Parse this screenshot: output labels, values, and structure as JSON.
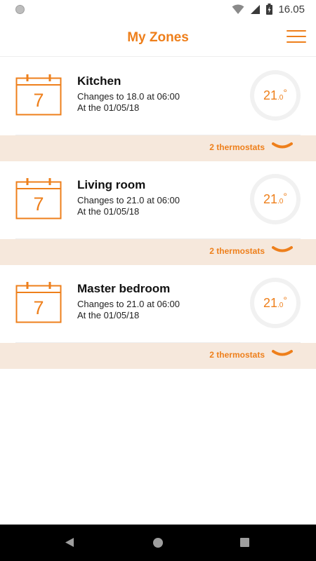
{
  "status_bar": {
    "time": "16.05",
    "icons": [
      "notification-dot-icon",
      "wifi-icon",
      "cell-signal-icon",
      "battery-charging-icon"
    ]
  },
  "header": {
    "title": "My Zones",
    "menu_icon": "hamburger-menu-icon"
  },
  "colors": {
    "accent": "#ee7f1b",
    "thermostat_bar_bg": "#f6e8dc",
    "nav_bar_bg": "#000000"
  },
  "zones": [
    {
      "name": "Kitchen",
      "calendar_day": "7",
      "change_text": "Changes to 18.0 at 06:00",
      "date_text": "At the 01/05/18",
      "temp_int": "21",
      "temp_dec": ".0",
      "temp_unit": "°",
      "thermostats_label": "2 thermostats"
    },
    {
      "name": "Living room",
      "calendar_day": "7",
      "change_text": "Changes to 21.0 at 06:00",
      "date_text": "At the 01/05/18",
      "temp_int": "21",
      "temp_dec": ".0",
      "temp_unit": "°",
      "thermostats_label": "2 thermostats"
    },
    {
      "name": "Master bedroom",
      "calendar_day": "7",
      "change_text": "Changes to 21.0 at 06:00",
      "date_text": "At the 01/05/18",
      "temp_int": "21",
      "temp_dec": ".0",
      "temp_unit": "°",
      "thermostats_label": "2 thermostats"
    }
  ],
  "nav_bar": {
    "icons": [
      "back-icon",
      "home-icon",
      "recents-icon"
    ]
  }
}
